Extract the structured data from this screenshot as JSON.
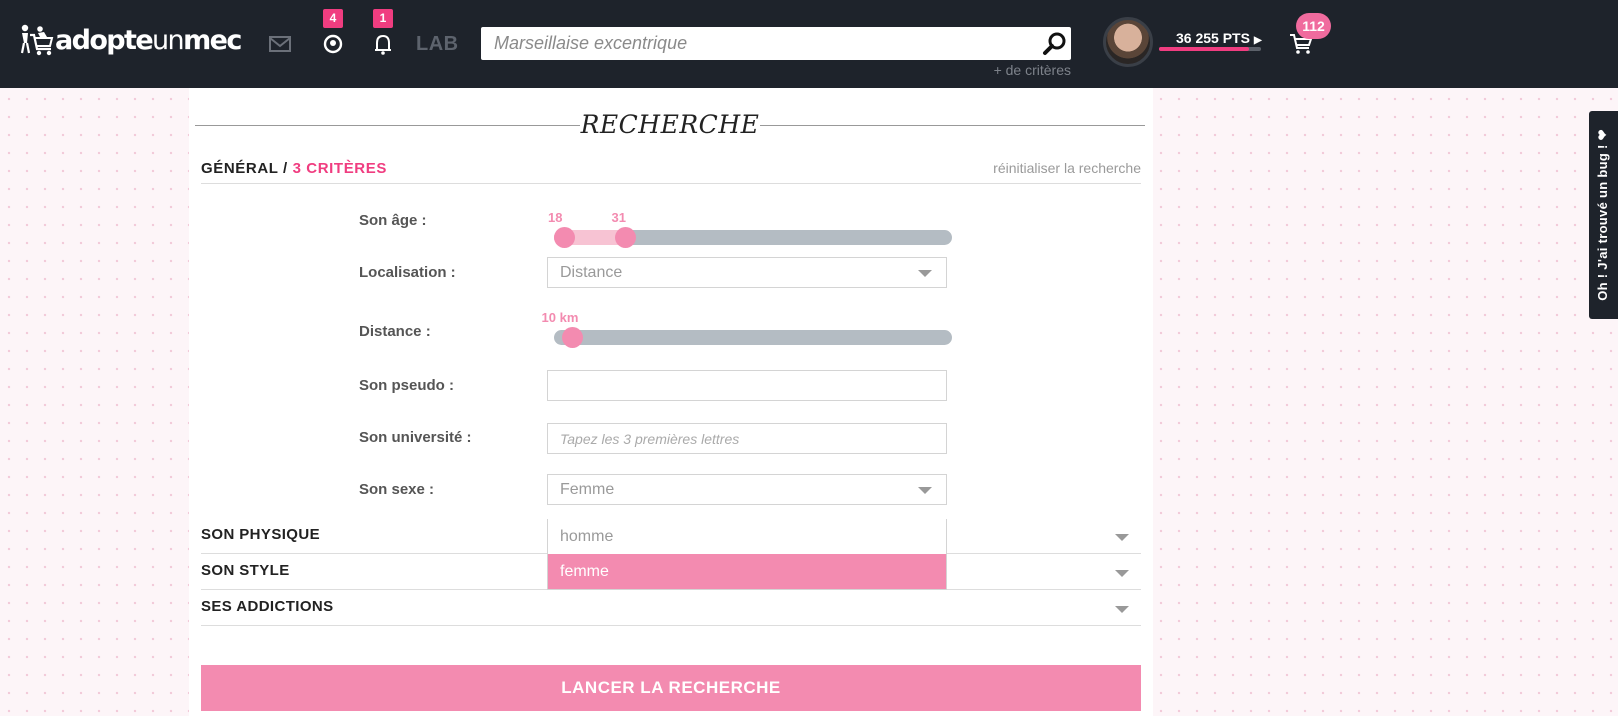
{
  "header": {
    "logo": {
      "text_bold": "adopte",
      "text_thin": "un",
      "text_end": "mec"
    },
    "nav": {
      "messages_icon": "envelope-icon",
      "visits_badge": "4",
      "notifications_badge": "1",
      "lab_label": "LAB"
    },
    "search": {
      "placeholder": "Marseillaise excentrique",
      "more_criteria": "+ de critères"
    },
    "user": {
      "points": "36 255 PTS",
      "points_progress": 0.88
    },
    "cart_badge": "112"
  },
  "search_panel": {
    "title": "RECHERCHE",
    "section": {
      "general": "GÉNÉRAL /",
      "criteria_count": "3 CRITÈRES",
      "reset": "réinitialiser la recherche"
    },
    "age": {
      "label": "Son âge :",
      "min": "18",
      "max": "31",
      "range_min": 18,
      "range_max": 99
    },
    "location": {
      "label": "Localisation :",
      "selected": "Distance"
    },
    "distance": {
      "label": "Distance :",
      "value": "10 km",
      "fraction": 0.02
    },
    "pseudo": {
      "label": "Son pseudo :",
      "value": ""
    },
    "university": {
      "label": "Son université :",
      "placeholder": "Tapez les 3 premières lettres"
    },
    "sex": {
      "label": "Son sexe :",
      "selected": "Femme",
      "options": [
        "homme",
        "femme"
      ],
      "active_index": 1
    },
    "collapsibles": [
      "SON PHYSIQUE",
      "SON STYLE",
      "SES ADDICTIONS"
    ],
    "submit": "LANCER LA RECHERCHE"
  },
  "side_tab": {
    "label": "Oh ! J'ai trouvé un bug !"
  },
  "colors": {
    "topbar": "#1e232b",
    "accent_pink": "#f03d80",
    "soft_pink": "#f38bb0",
    "track_grey": "#b4bcc3"
  }
}
